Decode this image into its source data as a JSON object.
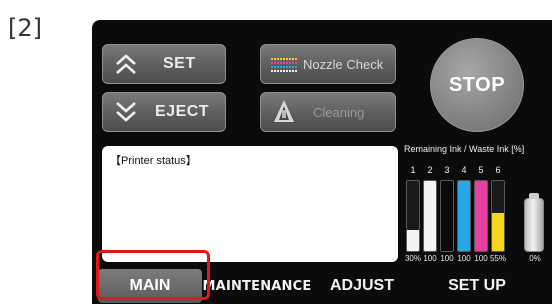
{
  "figure_label": "[2]",
  "buttons": {
    "set": "SET",
    "eject": "EJECT",
    "nozzle_check": "Nozzle Check",
    "cleaning": "Cleaning",
    "stop": "STOP"
  },
  "status_panel": {
    "title": "【Printer status】"
  },
  "ink_panel": {
    "title": "Remaining Ink / Waste Ink [%]",
    "slots": [
      {
        "num": "1",
        "pct": "30%",
        "level": 0.3,
        "color": "#f4f4f4"
      },
      {
        "num": "2",
        "pct": "100",
        "level": 1.0,
        "color": "#f4f4f4"
      },
      {
        "num": "3",
        "pct": "100",
        "level": 1.0,
        "color": "#0a0a0a"
      },
      {
        "num": "4",
        "pct": "100",
        "level": 1.0,
        "color": "#27a7e6"
      },
      {
        "num": "5",
        "pct": "100",
        "level": 1.0,
        "color": "#e63fa0"
      },
      {
        "num": "6",
        "pct": "55%",
        "level": 0.55,
        "color": "#f2d51c"
      }
    ],
    "waste_pct": "0%",
    "waste_level": 0.0
  },
  "tabs": {
    "main": "MAIN",
    "maintenance": "MAINTENANCE",
    "adjust": "ADJUST",
    "setup": "SET UP"
  },
  "colors": {
    "highlight": "#e01818",
    "screen_bg": "#0b0b0b"
  }
}
